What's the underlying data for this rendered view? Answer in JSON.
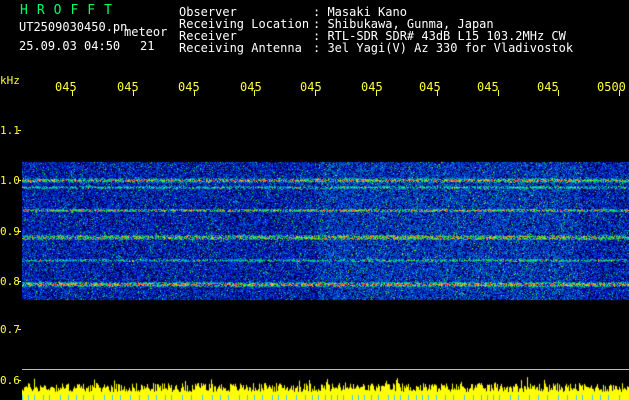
{
  "header": {
    "title": "HROFFT",
    "filename": "UT2509030450.pn",
    "mode": "meteor",
    "datetime": "25.09.03 04:50",
    "count": "21",
    "info": [
      {
        "label": "Observer",
        "value": ": Masaki Kano"
      },
      {
        "label": "Receiving Location",
        "value": ": Shibukawa, Gunma, Japan"
      },
      {
        "label": "Receiver",
        "value": ": RTL-SDR SDR# 43dB L15 103.2MHz CW"
      },
      {
        "label": "Receiving Antenna",
        "value": ": 3el Yagi(V) Az 330 for Vladivostok"
      }
    ]
  },
  "axis": {
    "unit": "kHz",
    "y_labels": [
      "1.1",
      "1.0",
      "0.9",
      "0.8",
      "0.7",
      "0.6"
    ],
    "time_labels": [
      "045",
      "045",
      "045",
      "045",
      "045",
      "045",
      "045",
      "045",
      "045",
      "0500"
    ]
  },
  "colors": {
    "background": "#000000",
    "text_header": "#ffffff",
    "text_title": "#00ff66",
    "axis": "#ffff33",
    "band_low": "#0010a0",
    "band_high": "#ff2020",
    "signal_bar": "#ffff00",
    "marker": "#33ccff"
  }
}
